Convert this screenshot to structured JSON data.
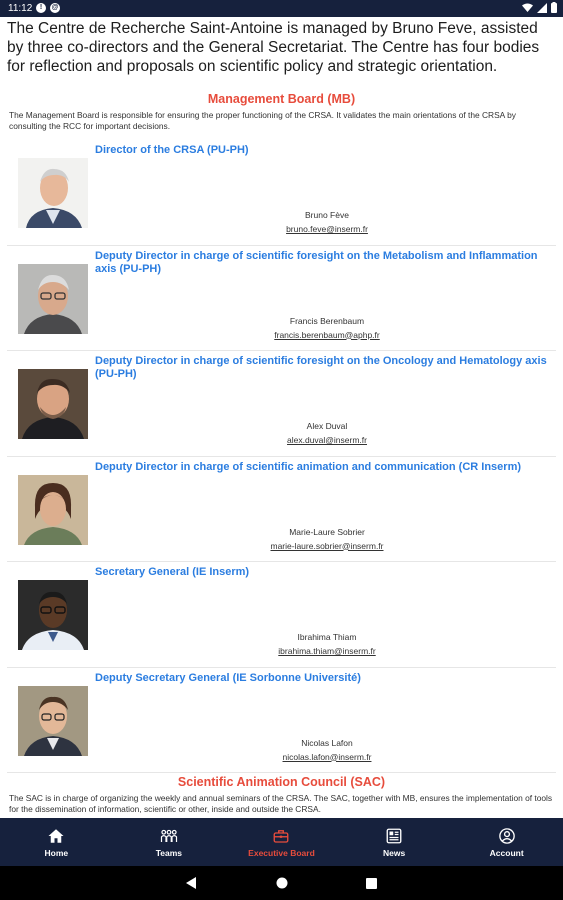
{
  "status": {
    "time": "11:12"
  },
  "intro": "The Centre de Recherche Saint-Antoine is managed by Bruno Feve, assisted by three co-directors and the General Secretariat. The Centre has four bodies for reflection and proposals on scientific policy and strategic orientation.",
  "management_board": {
    "title": "Management Board (MB)",
    "description": "The Management Board is responsible for ensuring the proper functioning of the CRSA. It validates the main orientations of the CRSA by consulting the RCC for important decisions.",
    "members": [
      {
        "role": "Director of the CRSA (PU-PH)",
        "name": "Bruno Fève",
        "email": "bruno.feve@inserm.fr"
      },
      {
        "role": "Deputy Director in charge of scientific foresight on the Metabolism and Inflammation axis (PU-PH)",
        "name": "Francis Berenbaum",
        "email": "francis.berenbaum@aphp.fr"
      },
      {
        "role": "Deputy Director in charge of scientific foresight on the Oncology and Hematology axis (PU-PH)",
        "name": "Alex Duval",
        "email": "alex.duval@inserm.fr"
      },
      {
        "role": "Deputy Director in charge of scientific animation and communication (CR Inserm)",
        "name": "Marie-Laure Sobrier",
        "email": "marie-laure.sobrier@inserm.fr"
      },
      {
        "role": "Secretary General (IE Inserm)",
        "name": "Ibrahima Thiam",
        "email": "ibrahima.thiam@inserm.fr"
      },
      {
        "role": "Deputy Secretary General (IE Sorbonne Université)",
        "name": "Nicolas Lafon",
        "email": "nicolas.lafon@inserm.fr"
      }
    ]
  },
  "sac": {
    "title": "Scientific Animation Council (SAC)",
    "description": "The SAC is in charge of organizing the weekly and annual seminars of the CRSA. The SAC, together with MB, ensures the implementation of tools for the dissemination of information, scientific or other, inside and outside the CRSA."
  },
  "nav": {
    "items": [
      {
        "label": "Home",
        "icon": "home-icon"
      },
      {
        "label": "Teams",
        "icon": "teams-icon"
      },
      {
        "label": "Executive Board",
        "icon": "executive-board-icon",
        "active": true
      },
      {
        "label": "News",
        "icon": "news-icon"
      },
      {
        "label": "Account",
        "icon": "account-icon"
      }
    ]
  },
  "colors": {
    "nav_bg": "#16213d",
    "accent": "#e74c3c",
    "link": "#2b7de0"
  }
}
